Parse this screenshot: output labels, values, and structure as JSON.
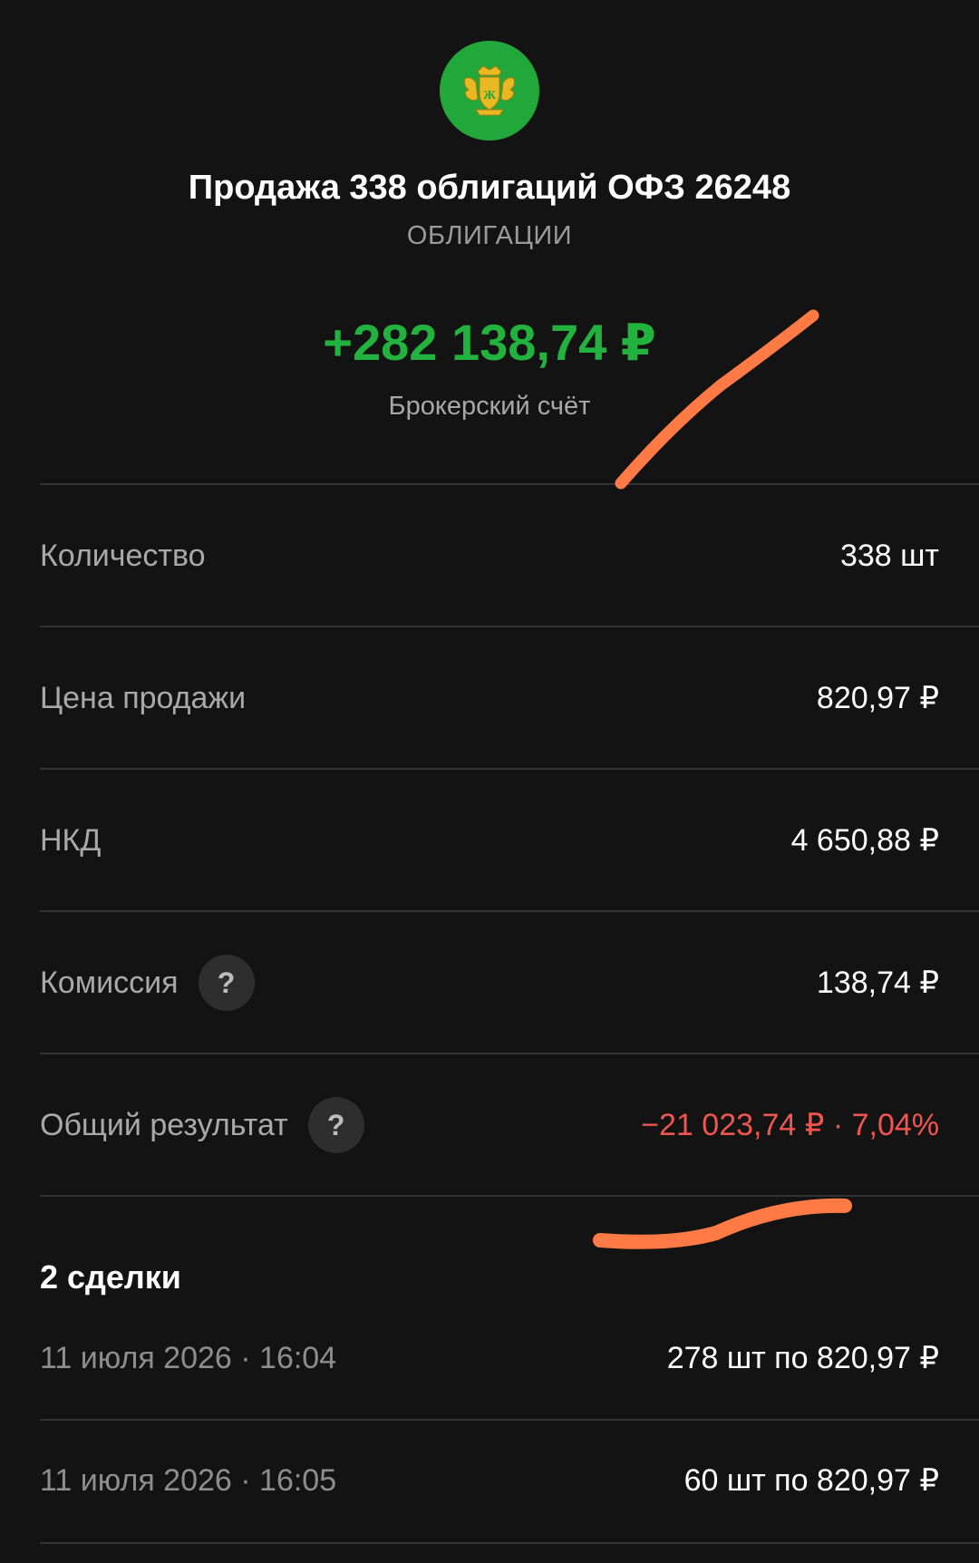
{
  "header": {
    "logo_icon": "bank-crest-icon",
    "title": "Продажа 338 облигаций ОФЗ 26248",
    "category": "ОБЛИГАЦИИ"
  },
  "summary": {
    "amount": "+282 138,74 ₽",
    "account": "Брокерский счёт"
  },
  "details": [
    {
      "label": "Количество",
      "value": "338 шт"
    },
    {
      "label": "Цена продажи",
      "value": "820,97 ₽"
    },
    {
      "label": "НКД",
      "value": "4 650,88 ₽"
    },
    {
      "label": "Комиссия",
      "value": "138,74 ₽",
      "help": "?"
    },
    {
      "label": "Общий результат",
      "value": "−21 023,74 ₽ · 7,04%",
      "help": "?"
    }
  ],
  "deals": {
    "heading": "2 сделки",
    "items": [
      {
        "date": "11 июля 2026 · 16:04",
        "amount": "278 шт по 820,97 ₽"
      },
      {
        "date": "11 июля 2026 · 16:05",
        "amount": "60 шт по 820,97 ₽"
      }
    ]
  },
  "colors": {
    "background": "#131313",
    "positive": "#22b33f",
    "negative": "#f0554f",
    "logo_bg": "#22a83a",
    "annotation": "#ff7a45"
  }
}
